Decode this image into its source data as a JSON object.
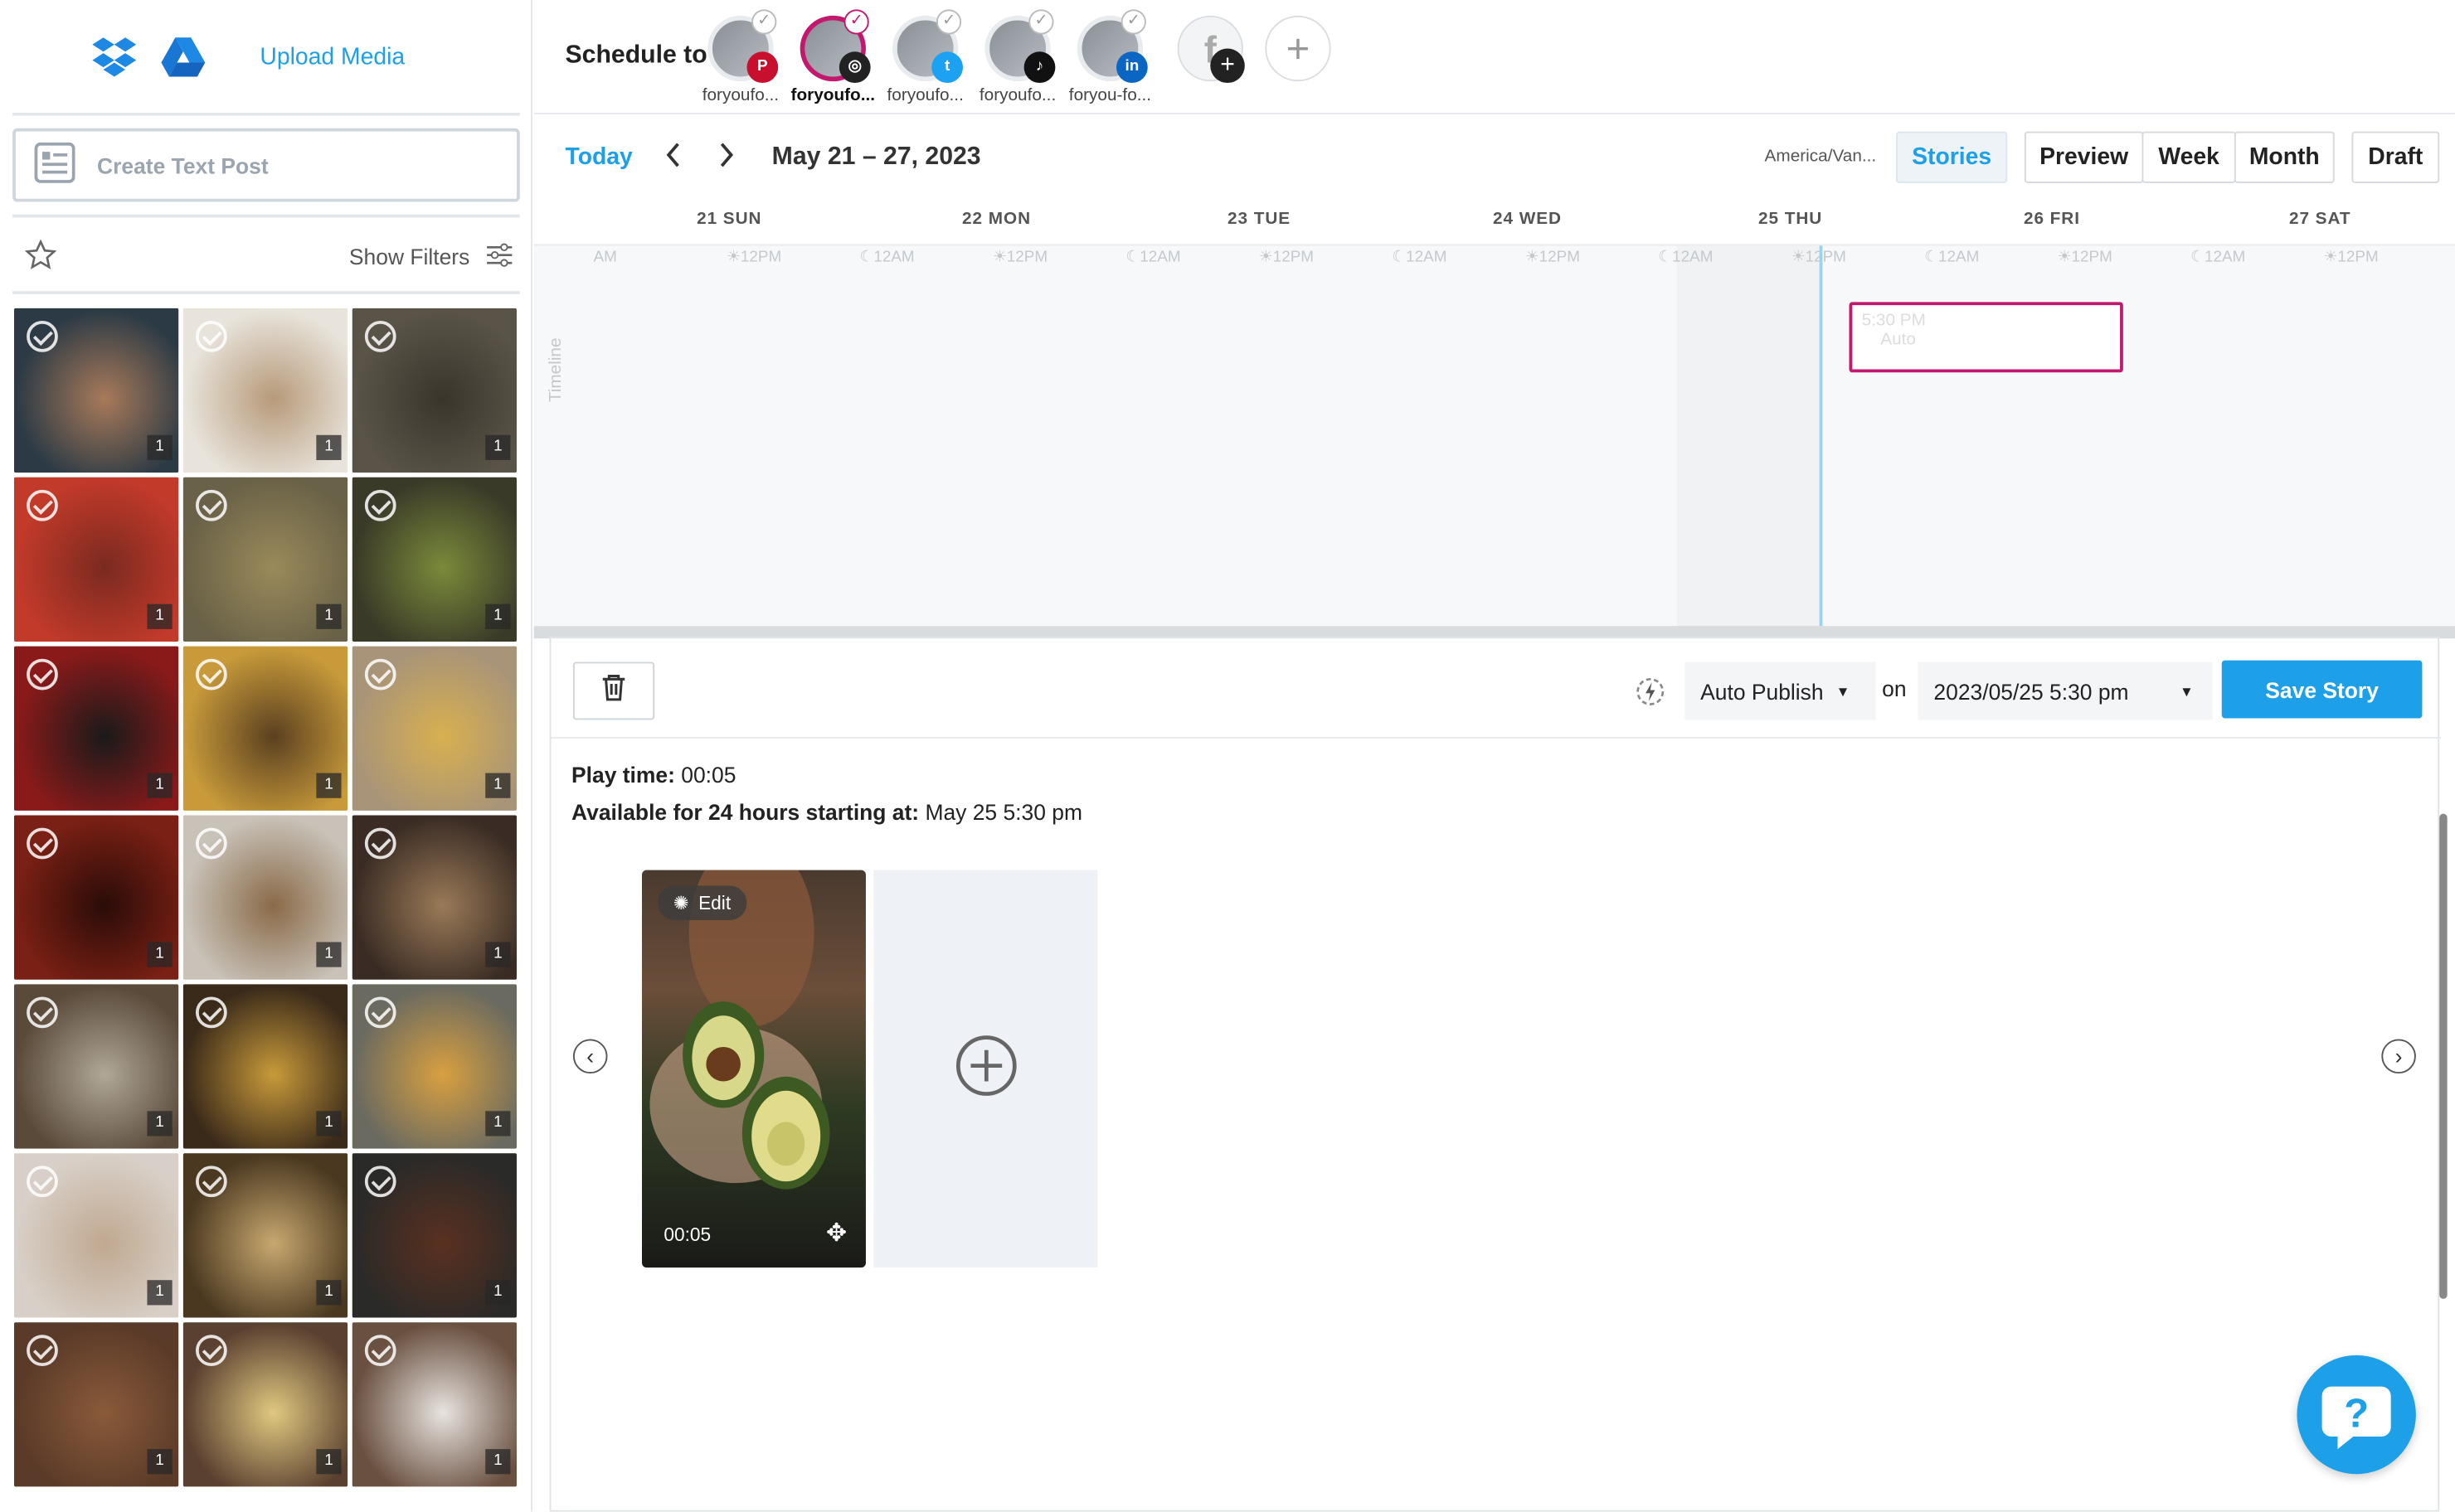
{
  "sidebar": {
    "upload_label": "Upload Media",
    "create_text_post": "Create Text Post",
    "show_filters": "Show Filters",
    "media": [
      {
        "count": "1",
        "colors": [
          "#2b3a44",
          "#a87a5a"
        ]
      },
      {
        "count": "1",
        "colors": [
          "#e8e4dc",
          "#b79a7a"
        ]
      },
      {
        "count": "1",
        "colors": [
          "#5a5448",
          "#3a352c"
        ]
      },
      {
        "count": "1",
        "colors": [
          "#c23a2a",
          "#7a2a20"
        ]
      },
      {
        "count": "1",
        "colors": [
          "#6a6248",
          "#9a8a5a"
        ]
      },
      {
        "count": "1",
        "colors": [
          "#3a3a28",
          "#7a8a3a"
        ]
      },
      {
        "count": "1",
        "colors": [
          "#8a1a1a",
          "#1a1a1a"
        ]
      },
      {
        "count": "1",
        "colors": [
          "#c89a3a",
          "#5a4020"
        ]
      },
      {
        "count": "1",
        "colors": [
          "#a89478",
          "#d8b050"
        ]
      },
      {
        "count": "1",
        "colors": [
          "#7a2014",
          "#2a0c08"
        ]
      },
      {
        "count": "1",
        "colors": [
          "#c8c2b8",
          "#8a6a48"
        ]
      },
      {
        "count": "1",
        "colors": [
          "#3a2c24",
          "#9a7a58"
        ]
      },
      {
        "count": "1",
        "colors": [
          "#5a4a3a",
          "#b0a898"
        ]
      },
      {
        "count": "1",
        "colors": [
          "#3a2a1a",
          "#c89a3a"
        ]
      },
      {
        "count": "1",
        "colors": [
          "#6a6a60",
          "#d8a040"
        ]
      },
      {
        "count": "1",
        "colors": [
          "#d8d0c8",
          "#c0a890"
        ]
      },
      {
        "count": "1",
        "colors": [
          "#4a3820",
          "#c8a870"
        ]
      },
      {
        "count": "1",
        "colors": [
          "#2a2a28",
          "#5a3020"
        ]
      },
      {
        "count": "1",
        "colors": [
          "#5a3a28",
          "#8a5a3a"
        ]
      },
      {
        "count": "1",
        "colors": [
          "#5a4030",
          "#e0c880"
        ]
      },
      {
        "count": "1",
        "colors": [
          "#6a5040",
          "#e8e4e0"
        ]
      }
    ]
  },
  "topbar": {
    "schedule_to": "Schedule to",
    "accounts": [
      {
        "name": "foryoufo...",
        "network": "pinterest",
        "net_color": "#c8102e",
        "net_glyph": "P",
        "selected": false
      },
      {
        "name": "foryoufo...",
        "network": "instagram",
        "net_color": "#222",
        "net_glyph": "◎",
        "selected": true
      },
      {
        "name": "foryoufo...",
        "network": "twitter",
        "net_color": "#1da1f2",
        "net_glyph": "t",
        "selected": false
      },
      {
        "name": "foryoufo...",
        "network": "tiktok",
        "net_color": "#111",
        "net_glyph": "♪",
        "selected": false
      },
      {
        "name": "foryou-fo...",
        "network": "linkedin",
        "net_color": "#0a66c2",
        "net_glyph": "in",
        "selected": false
      }
    ]
  },
  "calendar": {
    "today_label": "Today",
    "range": "May 21 – 27, 2023",
    "timezone": "America/Van...",
    "views": [
      "Stories",
      "Preview",
      "Week",
      "Month"
    ],
    "active_view": "Stories",
    "draft_label": "Draft",
    "days": [
      "21 SUN",
      "22 MON",
      "23 TUE",
      "24 WED",
      "25 THU",
      "26 FRI",
      "27 SAT"
    ],
    "ticks": [
      "AM",
      "☀12PM",
      "☾12AM",
      "☀12PM",
      "☾12AM",
      "☀12PM",
      "☾12AM",
      "☀12PM",
      "☾12AM",
      "☀12PM",
      "☾12AM",
      "☀12PM",
      "☾12AM",
      "☀12PM"
    ],
    "timeline_label": "Timeline",
    "event": {
      "time": "5:30 PM",
      "mode": "Auto"
    }
  },
  "editor": {
    "publish_mode": "Auto Publish",
    "on_label": "on",
    "datetime": "2023/05/25 5:30 pm",
    "save_label": "Save Story",
    "play_time_label": "Play time:",
    "play_time_value": "00:05",
    "available_label": "Available for 24 hours starting at:",
    "available_value": "May 25 5:30 pm",
    "slide": {
      "edit_label": "Edit",
      "duration": "00:05"
    }
  }
}
